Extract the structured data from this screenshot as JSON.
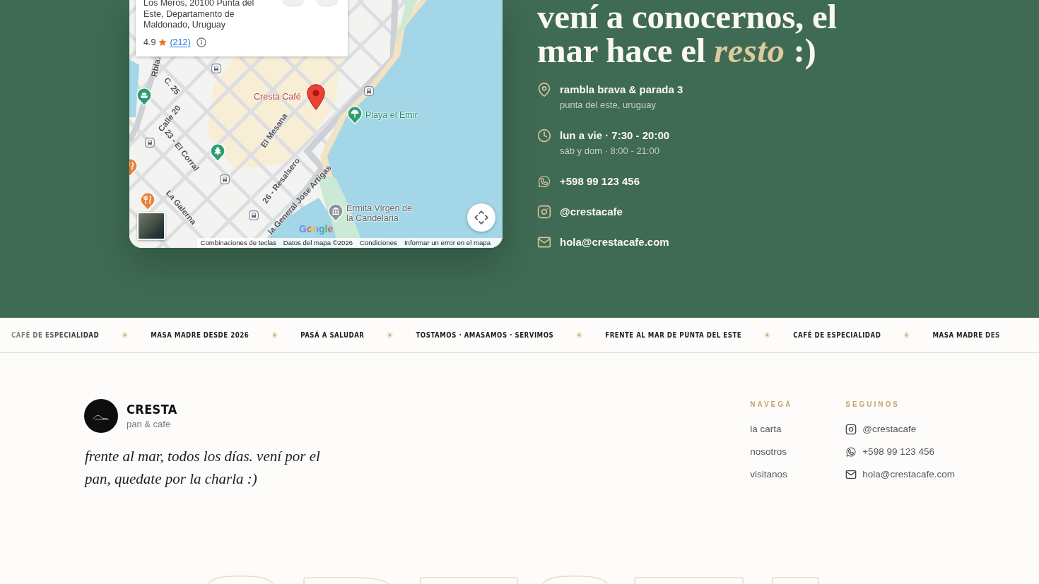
{
  "map": {
    "place_card": {
      "address": "Los Meros, 20100 Punta del Este, Departamento de Maldonado, Uruguay",
      "rating": "4.9",
      "reviews": "(212)"
    },
    "places": [
      {
        "label": "Cresta Café",
        "kind": "pin"
      },
      {
        "label": "Playa el Emir",
        "kind": "beach"
      },
      {
        "label": "Ermita Virgen de la Candelaria",
        "kind": "landmark"
      }
    ],
    "streets": [
      "Rbla.",
      "C. 25",
      "Calle 20",
      "23 - El Corral",
      "El Mesana",
      "26 - Resalsero",
      "La Galerna",
      "la General Jose Artigas"
    ],
    "logo": "Google",
    "attribution": [
      "Combinaciones de teclas",
      "Datos del mapa ©2026",
      "Condiciones",
      "Informar un error en el mapa"
    ]
  },
  "heading": "vení a conocernos, el mar hace el *resto* :)",
  "contact": [
    {
      "kind": "address",
      "title": "rambla brava & parada 3",
      "detail": "punta del este, uruguay"
    },
    {
      "kind": "hours",
      "title": "lun a vie · 7:30 - 20:00",
      "detail": "sáb y dom · 8:00 - 21:00"
    },
    {
      "kind": "whatsapp",
      "title": "+598 99 123 456"
    },
    {
      "kind": "instagram",
      "title": "@crestacafe"
    },
    {
      "kind": "email",
      "title": "hola@crestacafe.com"
    }
  ],
  "marquee": [
    "CAFÉ DE ESPECIALIDAD",
    "MASA MADRE DESDE 2026",
    "PASÁ A SALUDAR",
    "TOSTAMOS · AMASAMOS · SERVIMOS",
    "FRENTE AL MAR DE PUNTA DEL ESTE",
    "CAFÉ DE ESPECIALIDAD",
    "MASA MADRE DES"
  ],
  "footer": {
    "brand": {
      "name": "CRESTA",
      "tagline": "pan & cafe"
    },
    "motto": "frente al mar, todos los días. vení por el pan, quedate por la charla :)",
    "columns": [
      {
        "title": "NAVEGÁ",
        "links": [
          {
            "label": "la carta"
          },
          {
            "label": "nosotros"
          },
          {
            "label": "visitanos"
          }
        ]
      },
      {
        "title": "SEGUINOS",
        "links": [
          {
            "kind": "instagram",
            "label": "@crestacafe"
          },
          {
            "kind": "whatsapp",
            "label": "+598 99 123 456"
          },
          {
            "kind": "email",
            "label": "hola@crestacafe.com"
          }
        ]
      }
    ]
  }
}
